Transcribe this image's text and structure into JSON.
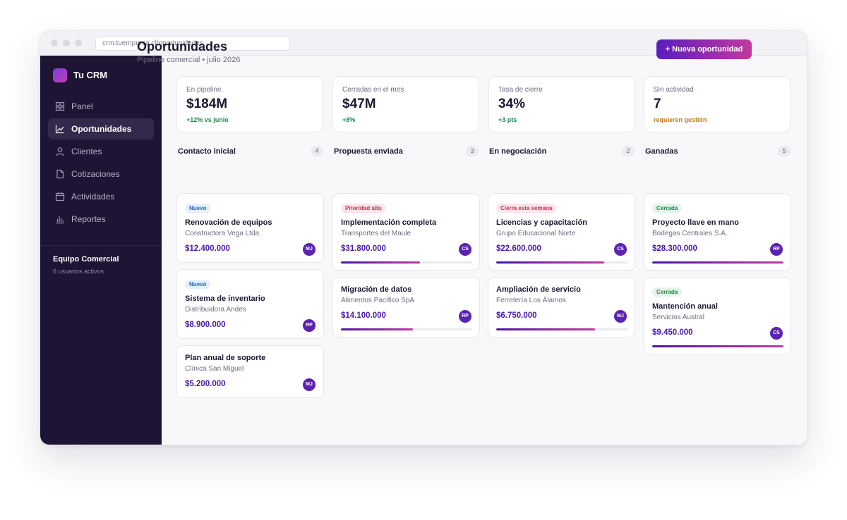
{
  "browser": {
    "url": "crm.tuempresa.cl/oportunidades"
  },
  "sidebar": {
    "brand": "Tu CRM",
    "items": [
      {
        "label": "Panel",
        "icon": "grid-icon",
        "active": false
      },
      {
        "label": "Oportunidades",
        "icon": "trend-icon",
        "active": true
      },
      {
        "label": "Clientes",
        "icon": "user-icon",
        "active": false
      },
      {
        "label": "Cotizaciones",
        "icon": "document-icon",
        "active": false
      },
      {
        "label": "Actividades",
        "icon": "calendar-icon",
        "active": false
      },
      {
        "label": "Reportes",
        "icon": "bar-chart-icon",
        "active": false
      }
    ],
    "team": {
      "name": "Equipo Comercial",
      "subtitle": "6 usuarios activos"
    }
  },
  "header": {
    "title": "Oportunidades",
    "subtitle": "Pipeline comercial • julio 2026",
    "new_button": "+ Nueva oportunidad"
  },
  "kpis": [
    {
      "label": "En pipeline",
      "value": "$184M",
      "note": "+12% vs junio",
      "tone": "positive"
    },
    {
      "label": "Cerradas en el mes",
      "value": "$47M",
      "note": "+8%",
      "tone": "positive"
    },
    {
      "label": "Tasa de cierre",
      "value": "34%",
      "note": "+3 pts",
      "tone": "positive"
    },
    {
      "label": "Sin actividad",
      "value": "7",
      "note": "requieren gestión",
      "tone": "warning"
    }
  ],
  "columns": [
    {
      "title": "Contacto inicial",
      "count": "4",
      "cards": [
        {
          "badge": "Nuevo",
          "badge_type": "new",
          "title": "Renovación de equipos",
          "company": "Constructora Vega Ltda.",
          "amount": "$12.400.000",
          "owner": "MJ"
        },
        {
          "badge": "Nuevo",
          "badge_type": "new",
          "title": "Sistema de inventario",
          "company": "Distribuidora Andes",
          "amount": "$8.900.000",
          "owner": "RP"
        },
        {
          "badge": "",
          "badge_type": "",
          "title": "Plan anual de soporte",
          "company": "Clínica San Miguel",
          "amount": "$5.200.000",
          "owner": "MJ"
        }
      ]
    },
    {
      "title": "Propuesta enviada",
      "count": "3",
      "cards": [
        {
          "badge": "Prioridad alta",
          "badge_type": "high",
          "title": "Implementación completa",
          "company": "Transportes del Maule",
          "amount": "$31.800.000",
          "owner": "CS",
          "progress": 0.6
        },
        {
          "badge": "",
          "badge_type": "",
          "title": "Migración de datos",
          "company": "Alimentos Pacífico SpA",
          "amount": "$14.100.000",
          "owner": "RP",
          "progress": 0.55
        }
      ]
    },
    {
      "title": "En negociación",
      "count": "2",
      "cards": [
        {
          "badge": "Cierra esta semana",
          "badge_type": "high",
          "title": "Licencias y capacitación",
          "company": "Grupo Educacional Norte",
          "amount": "$22.600.000",
          "owner": "CS",
          "progress": 0.82
        },
        {
          "badge": "",
          "badge_type": "",
          "title": "Ampliación de servicio",
          "company": "Ferretería Los Álamos",
          "amount": "$6.750.000",
          "owner": "MJ",
          "progress": 0.75
        }
      ]
    },
    {
      "title": "Ganadas",
      "count": "5",
      "cards": [
        {
          "badge": "Cerrada",
          "badge_type": "won",
          "title": "Proyecto llave en mano",
          "company": "Bodegas Centrales S.A.",
          "amount": "$28.300.000",
          "owner": "RP",
          "progress": 1.0
        },
        {
          "badge": "Cerrada",
          "badge_type": "won",
          "title": "Mantención anual",
          "company": "Servicios Austral",
          "amount": "$9.450.000",
          "owner": "CS",
          "progress": 1.0
        }
      ]
    }
  ],
  "colors": {
    "sidebar_bg": "#1e1433",
    "accent": "#5a1dbd",
    "accent_end": "#c13a9e",
    "positive": "#1e8a4e",
    "warning": "#c27e12",
    "danger": "#c6344f"
  }
}
